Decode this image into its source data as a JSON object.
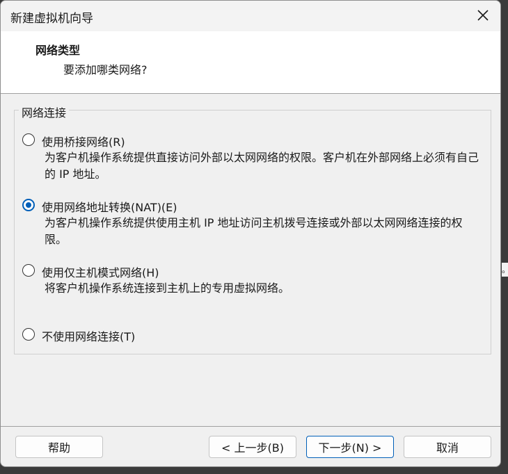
{
  "window": {
    "title": "新建虚拟机向导",
    "close_icon": "close-icon"
  },
  "header": {
    "title": "网络类型",
    "subtitle": "要添加哪类网络?"
  },
  "group": {
    "label": "网络连接",
    "options": [
      {
        "label": "使用桥接网络(R)",
        "description": "为客户机操作系统提供直接访问外部以太网网络的权限。客户机在外部网络上必须有自己的 IP 地址。",
        "checked": false
      },
      {
        "label": "使用网络地址转换(NAT)(E)",
        "description": "为客户机操作系统提供使用主机 IP 地址访问主机拨号连接或外部以太网网络连接的权限。",
        "checked": true
      },
      {
        "label": "使用仅主机模式网络(H)",
        "description": "将客户机操作系统连接到主机上的专用虚拟网络。",
        "checked": false
      },
      {
        "label": "不使用网络连接(T)",
        "description": "",
        "checked": false
      }
    ]
  },
  "buttons": {
    "help": "帮助",
    "back": "< 上一步(B)",
    "next": "下一步(N) >",
    "cancel": "取消"
  },
  "edge_fragment": "。",
  "colors": {
    "accent": "#005fb8",
    "dialog_bg": "#f0f0f0",
    "header_bg": "#ffffff"
  }
}
